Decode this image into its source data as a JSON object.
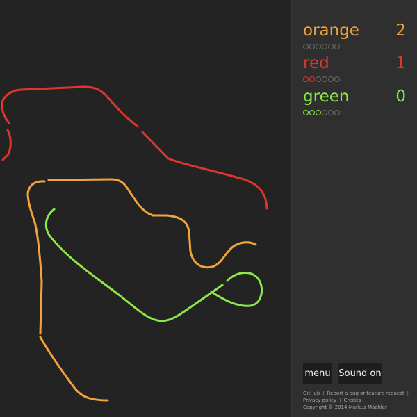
{
  "players": [
    {
      "name": "orange",
      "score": "2",
      "color": "#f2a33a",
      "lives_total": 6,
      "lives_filled": 0
    },
    {
      "name": "red",
      "score": "1",
      "color": "#e0362a",
      "lives_total": 6,
      "lives_filled": 2
    },
    {
      "name": "green",
      "score": "0",
      "color": "#8ee64a",
      "lives_total": 6,
      "lives_filled": 3
    }
  ],
  "buttons": {
    "menu": "menu",
    "sound": "Sound on"
  },
  "footer": {
    "github": "GitHub",
    "report": "Report a bug or feature request",
    "privacy": "Privacy policy",
    "credits": "Credits",
    "copyright": "Copyright © 2014 Markus Mächler"
  },
  "colors": {
    "field_background": "#232323",
    "sidebar_background": "#2f2f2f",
    "button_background": "#1d1d1d",
    "empty_life": "#6a6a6a"
  }
}
